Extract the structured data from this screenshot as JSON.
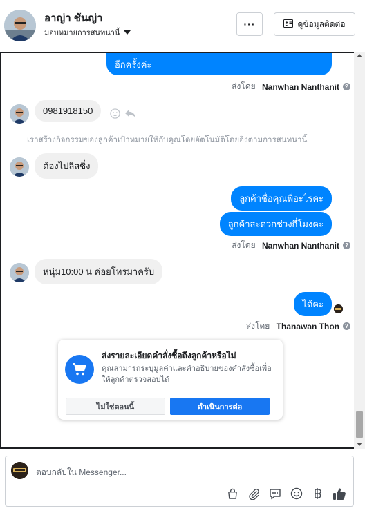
{
  "header": {
    "contact_name": "อาญ่า ชันญ่า",
    "assign_label": "มอบหมายการสนทนานี้",
    "more_button": "···",
    "info_button": "ดูข้อมูลติดต่อ"
  },
  "messages": {
    "out1": [
      "",
      "อีกครั้งค่ะ"
    ],
    "sent_by_prefix": "ส่งโดย",
    "sent_by_1": "Nanwhan Nanthanit",
    "in_phone": "0981918150",
    "system_note": "เราสร้างกิจกรรมของลูกค้าเป้าหมายให้กับคุณโดยอัตโนมัติโดยอิงตามการสนทนานี้",
    "in_slip": "ต้องไปลิสซิ่ง",
    "out2": "ลูกค้าชื่อคุณพี่อะไรคะ",
    "out3": "ลูกค้าสะดวกช่วงกี่โมงคะ",
    "sent_by_2": "Nanwhan Nanthanit",
    "in_time": "หนุ่ม10:00 น ค่อยโทรมาครับ",
    "out4": "ได้คะ",
    "sent_by_3": "Thanawan Thon"
  },
  "card": {
    "title": "ส่งรายละเอียดคำสั่งซื้อถึงลูกค้าหรือไม่",
    "description": "คุณสามารถระบุมูลค่าและคำอธิบายของคำสั่งซื้อเพื่อให้ลูกค้าตรวจสอบได้",
    "no_label": "ไม่ใช่ตอนนี้",
    "yes_label": "ดำเนินการต่อ"
  },
  "composer": {
    "placeholder": "ตอบกลับใน Messenger..."
  },
  "colors": {
    "accent": "#1877f2",
    "bubble_out": "#0084ff",
    "bubble_in": "#f0f0f0"
  },
  "icons": [
    "chevron-down-icon",
    "more-icon",
    "contact-card-icon",
    "help-icon",
    "smile-icon",
    "reply-icon",
    "cart-icon",
    "bag-icon",
    "attach-icon",
    "chat-icon",
    "emoji-icon",
    "baht-icon",
    "like-icon"
  ]
}
